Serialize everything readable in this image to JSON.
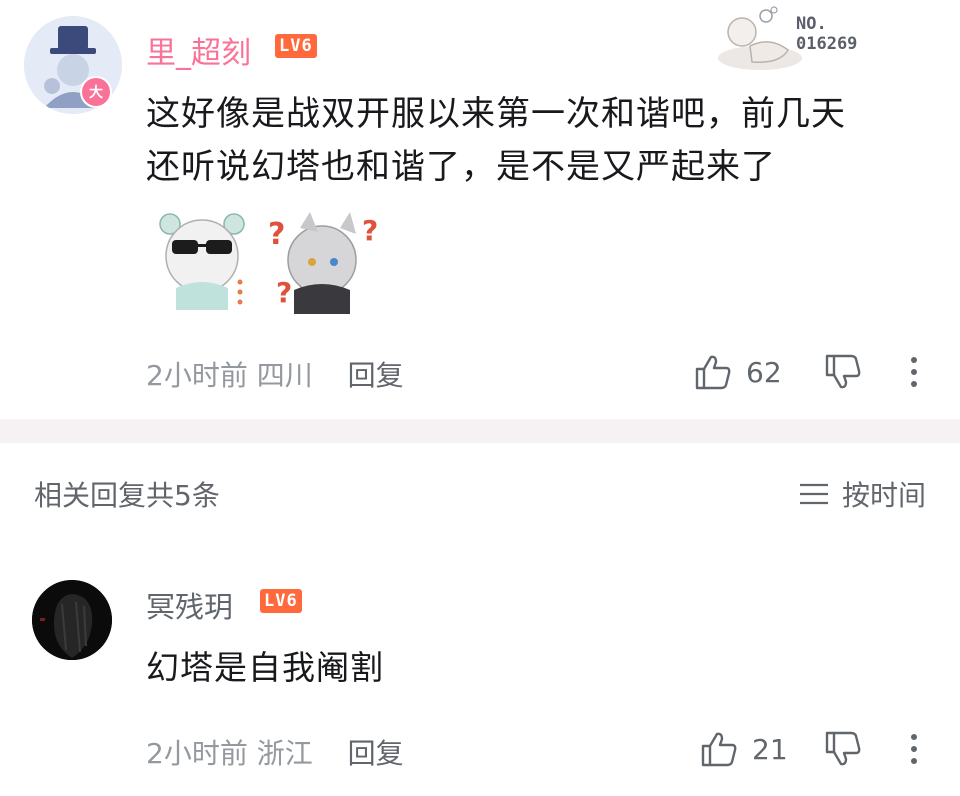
{
  "main_comment": {
    "username": "里_超刻",
    "level_badge": "LV6",
    "avatar_badge": "大",
    "fan_badge_no": "NO.",
    "fan_badge_number": "016269",
    "content_line1": "这好像是战双开服以来第一次和谐吧，前几天",
    "content_line2": "还听说幻塔也和谐了，是不是又严起来了",
    "time": "2小时前",
    "location": "四川",
    "reply_label": "回复",
    "like_count": "62"
  },
  "section": {
    "title": "相关回复共5条",
    "sort_label": "按时间"
  },
  "reply": {
    "username": "冥残玥",
    "level_badge": "LV6",
    "content": "幻塔是自我阉割",
    "time": "2小时前",
    "location": "浙江",
    "reply_label": "回复",
    "like_count": "21"
  },
  "colors": {
    "username_vip": "#fb7299",
    "level_badge": "#ff6a3d",
    "meta_gray": "#9499a0",
    "divider": "#f6f1f3"
  },
  "icons": [
    "thumb-up-icon",
    "thumb-down-icon",
    "more-vertical-icon",
    "sort-lines-icon"
  ]
}
